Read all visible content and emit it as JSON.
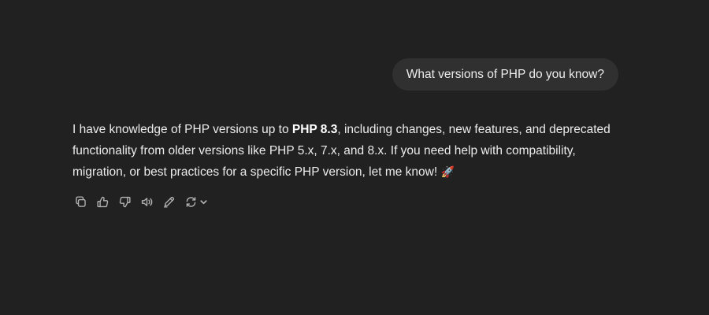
{
  "conversation": {
    "user_message": "What versions of PHP do you know?",
    "assistant_message": {
      "part1": "I have knowledge of PHP versions up to ",
      "bold": "PHP 8.3",
      "part2": ", including changes, new features, and deprecated functionality from older versions like PHP 5.x, 7.x, and 8.x. If you need help with compatibility, migration, or best practices for a specific PHP version, let me know! ",
      "emoji": "🚀"
    }
  },
  "actions": [
    {
      "name": "copy-icon"
    },
    {
      "name": "thumbs-up-icon"
    },
    {
      "name": "thumbs-down-icon"
    },
    {
      "name": "read-aloud-icon"
    },
    {
      "name": "edit-icon"
    },
    {
      "name": "regenerate-icon"
    },
    {
      "name": "chevron-down-icon"
    }
  ]
}
